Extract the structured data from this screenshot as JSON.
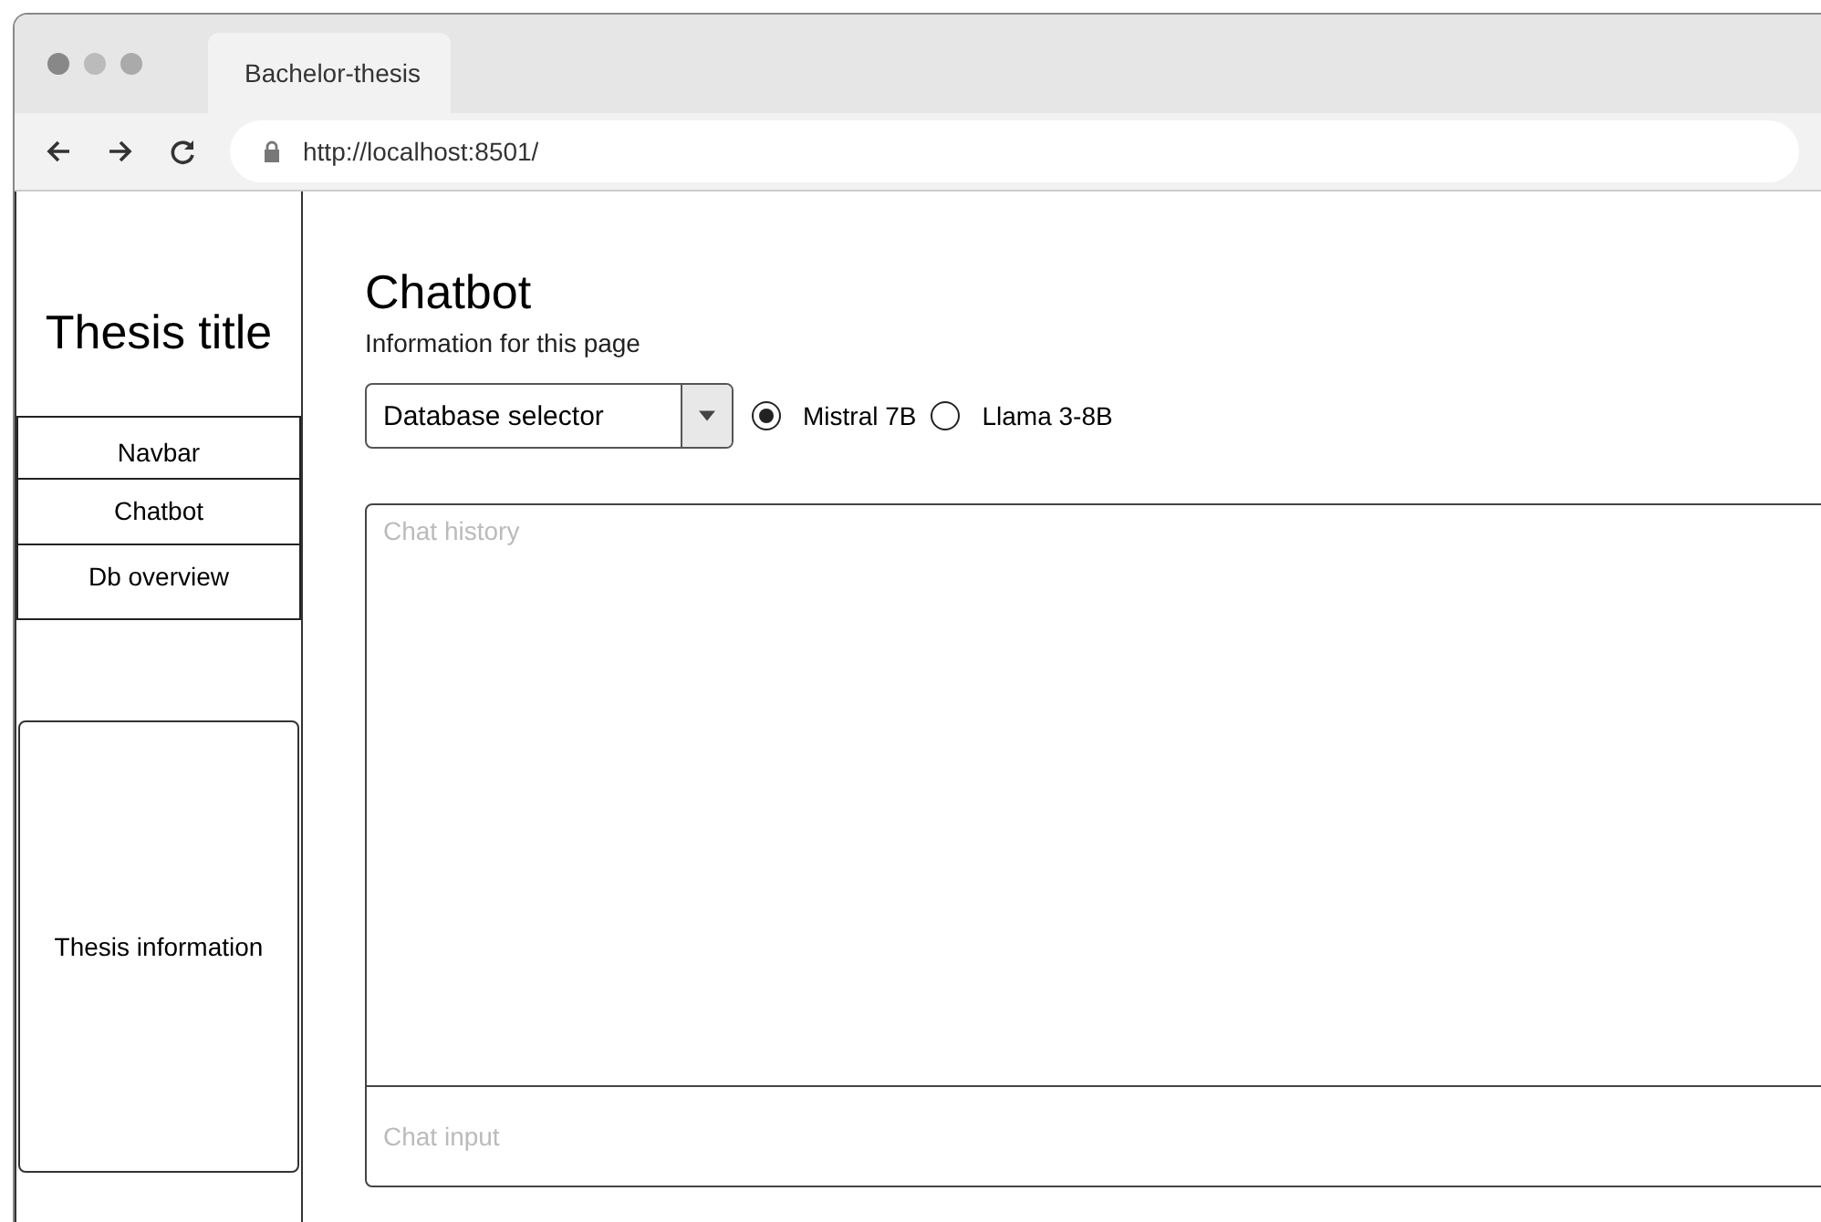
{
  "browser": {
    "tab_title": "Bachelor-thesis",
    "url": "http://localhost:8501/"
  },
  "sidebar": {
    "title": "Thesis title",
    "nav_items": [
      "Navbar",
      "Chatbot",
      "Db overview"
    ],
    "info": "Thesis information"
  },
  "main": {
    "title": "Chatbot",
    "subtitle": "Information for this page",
    "database_selector": {
      "value": "Database selector"
    },
    "models": [
      {
        "label": "Mistral 7B",
        "selected": true
      },
      {
        "label": "Llama 3-8B",
        "selected": false
      }
    ],
    "chat_history": {
      "placeholder": "Chat history"
    },
    "chat_input": {
      "placeholder": "Chat input"
    }
  }
}
